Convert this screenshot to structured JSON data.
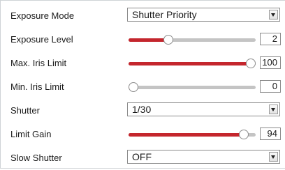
{
  "settings": {
    "exposure_mode": {
      "label": "Exposure Mode",
      "value": "Shutter Priority"
    },
    "exposure_level": {
      "label": "Exposure Level",
      "value": "2",
      "level": 0.3
    },
    "max_iris_limit": {
      "label": "Max. Iris Limit",
      "value": "100",
      "level": 1.0
    },
    "min_iris_limit": {
      "label": "Min. Iris Limit",
      "value": "0",
      "level": 0.0
    },
    "shutter": {
      "label": "Shutter",
      "value": "1/30"
    },
    "limit_gain": {
      "label": "Limit Gain",
      "value": "94",
      "level": 0.94
    },
    "slow_shutter": {
      "label": "Slow Shutter",
      "value": "OFF"
    }
  },
  "colors": {
    "slider_fill": "#c4262d",
    "slider_track": "#c4c4c4"
  }
}
